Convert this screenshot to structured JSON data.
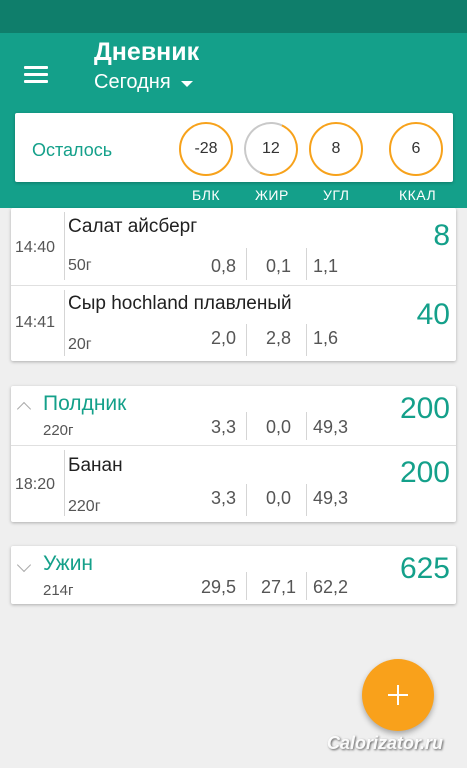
{
  "header": {
    "title": "Дневник",
    "date_filter": "Сегодня",
    "menu_icon": "hamburger-icon"
  },
  "summary": {
    "label": "Осталось",
    "rings": [
      {
        "value": "-28",
        "label": "БЛК"
      },
      {
        "value": "12",
        "label": "ЖИР"
      },
      {
        "value": "8",
        "label": "УГЛ"
      },
      {
        "value": "6",
        "label": "ККАЛ"
      }
    ],
    "accent_color": "#14a08a",
    "ring_color": "#f7a21b"
  },
  "breakfast_items": [
    {
      "time": "14:40",
      "name": "Салат айсберг",
      "weight": "50г",
      "protein": "0,8",
      "fat": "0,1",
      "carbs": "1,1",
      "kcal": "8"
    },
    {
      "time": "14:41",
      "name": "Сыр hochland плавленый",
      "weight": "20г",
      "protein": "2,0",
      "fat": "2,8",
      "carbs": "1,6",
      "kcal": "40"
    }
  ],
  "snack": {
    "title": "Полдник",
    "weight": "220г",
    "protein": "3,3",
    "fat": "0,0",
    "carbs": "49,3",
    "kcal": "200",
    "items": [
      {
        "time": "18:20",
        "name": "Банан",
        "weight": "220г",
        "protein": "3,3",
        "fat": "0,0",
        "carbs": "49,3",
        "kcal": "200"
      }
    ]
  },
  "dinner": {
    "title": "Ужин",
    "weight": "214г",
    "protein": "29,5",
    "fat": "27,1",
    "carbs": "62,2",
    "kcal": "625"
  },
  "fab_icon": "plus-icon",
  "watermark": "Calorizator.ru"
}
